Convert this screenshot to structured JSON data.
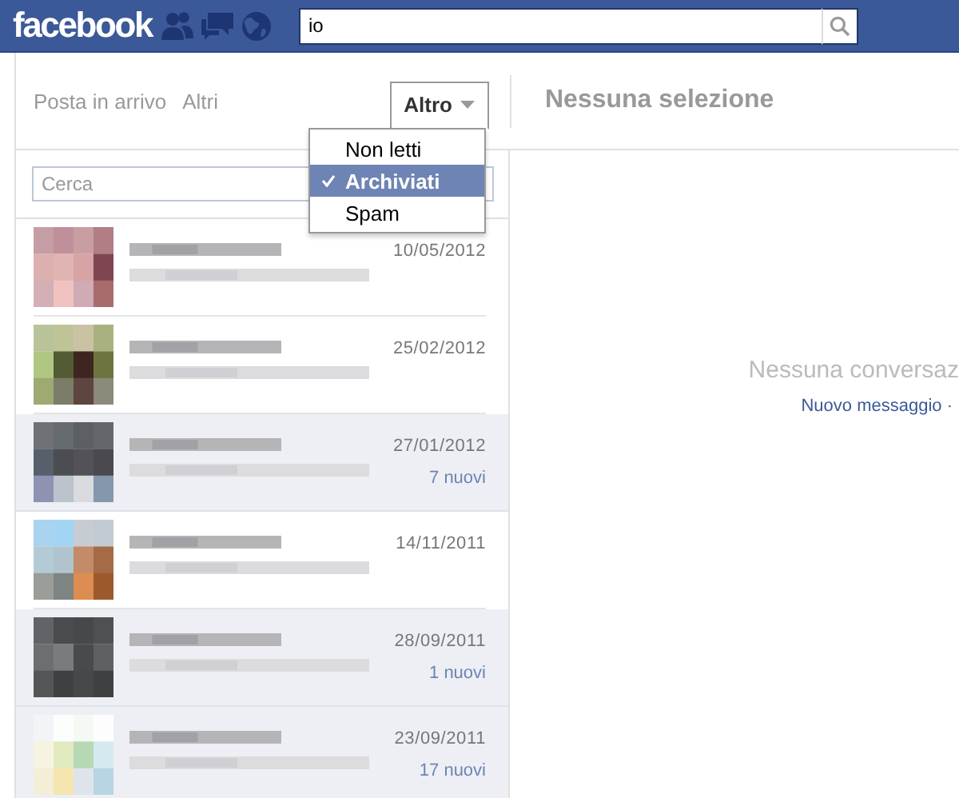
{
  "header": {
    "logo": "facebook",
    "search": {
      "value": "io"
    }
  },
  "toolbar": {
    "tabs": [
      {
        "label": "Posta in arrivo",
        "selected": false
      },
      {
        "label": "Altri",
        "selected": false
      }
    ],
    "filter_button": {
      "label": "Altro",
      "expanded": true
    },
    "heading": "Nessuna selezione"
  },
  "filter_menu": [
    {
      "label": "Non letti",
      "selected": false
    },
    {
      "label": "Archiviati",
      "selected": true
    },
    {
      "label": "Spam",
      "selected": false
    }
  ],
  "search": {
    "placeholder": "Cerca"
  },
  "conversations": [
    {
      "date": "10/05/2012",
      "unread": false
    },
    {
      "date": "25/02/2012",
      "unread": false
    },
    {
      "date": "27/01/2012",
      "unread": true,
      "new_count": "7 nuovi"
    },
    {
      "date": "14/11/2011",
      "unread": false
    },
    {
      "date": "28/09/2011",
      "unread": true,
      "new_count": "1 nuovi"
    },
    {
      "date": "23/09/2011",
      "unread": true,
      "new_count": "17 nuovi"
    }
  ],
  "empty_state": {
    "title": "Nessuna conversaz",
    "link": "Nuovo messaggio ·"
  }
}
